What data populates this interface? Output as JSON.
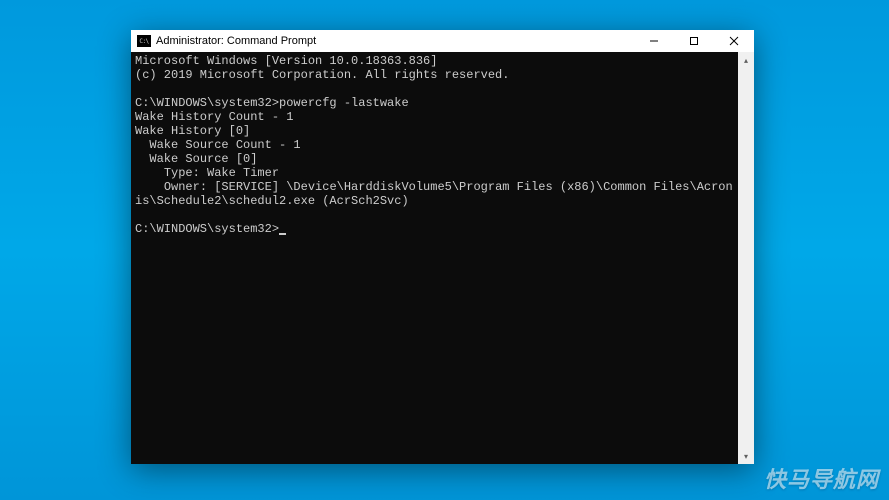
{
  "window": {
    "title": "Administrator: Command Prompt",
    "icon_label": "cmd"
  },
  "terminal": {
    "lines": [
      "Microsoft Windows [Version 10.0.18363.836]",
      "(c) 2019 Microsoft Corporation. All rights reserved.",
      "",
      "C:\\WINDOWS\\system32>powercfg -lastwake",
      "Wake History Count - 1",
      "Wake History [0]",
      "  Wake Source Count - 1",
      "  Wake Source [0]",
      "    Type: Wake Timer",
      "    Owner: [SERVICE] \\Device\\HarddiskVolume5\\Program Files (x86)\\Common Files\\Acronis\\Schedule2\\schedul2.exe (AcrSch2Svc)",
      ""
    ],
    "prompt": "C:\\WINDOWS\\system32>"
  },
  "controls": {
    "minimize": "minimize",
    "maximize": "maximize",
    "close": "close"
  },
  "scrollbar": {
    "up": "▴",
    "down": "▾"
  },
  "watermark": "快马导航网"
}
